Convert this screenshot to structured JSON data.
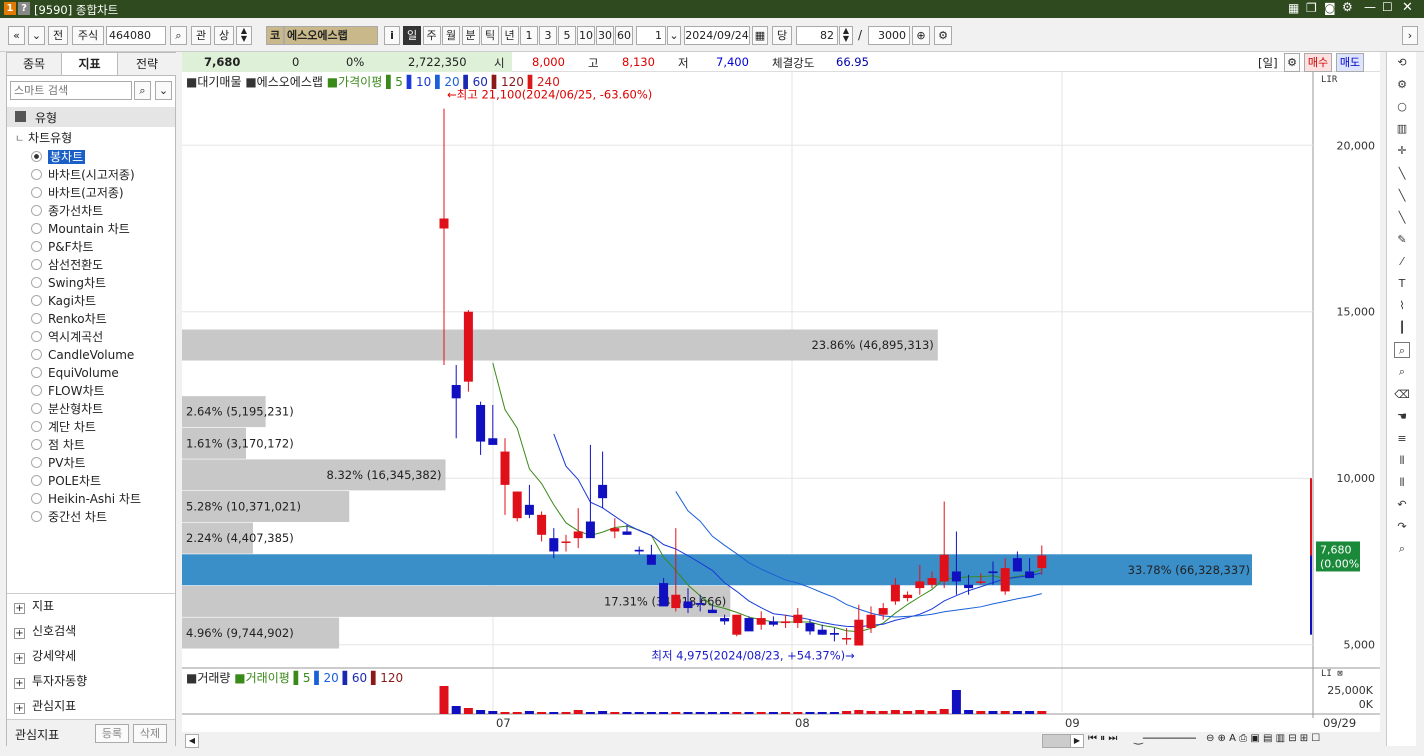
{
  "window": {
    "title": "[9590] 종합차트",
    "icons": [
      "table-icon",
      "copy-icon",
      "camera-icon",
      "gear-icon",
      "minimize-icon",
      "maximize-icon",
      "close-icon"
    ]
  },
  "toolbar": {
    "market": "전",
    "type": "주식",
    "code": "464080",
    "search_icon": "search-icon",
    "btn_gwan": "관",
    "btn_sang": "상",
    "stock_badge": "코",
    "stock_name": "에스오에스랩",
    "info_btn": "i",
    "periods": [
      "일",
      "주",
      "월",
      "분",
      "틱",
      "년"
    ],
    "active_period": "일",
    "intervals": [
      "1",
      "3",
      "5",
      "10",
      "30",
      "60"
    ],
    "count": "1",
    "date": "2024/09/24",
    "dang_label": "당",
    "zoom_value": "82",
    "slash": "/",
    "total": "3000"
  },
  "left_panel": {
    "tabs": [
      "종목",
      "지표",
      "전략"
    ],
    "active_tab": "지표",
    "search_placeholder": "스마트 검색",
    "group": "유형",
    "subgroup": "차트유형",
    "chart_types": [
      "봉차트",
      "바차트(시고저종)",
      "바차트(고저종)",
      "종가선차트",
      "Mountain 차트",
      "P&F차트",
      "삼선전환도",
      "Swing차트",
      "Kagi차트",
      "Renko차트",
      "역시계곡선",
      "CandleVolume",
      "EquiVolume",
      "FLOW차트",
      "분산형차트",
      "계단 차트",
      "점 차트",
      "PV차트",
      "POLE차트",
      "Heikin-Ashi 차트",
      "중간선 차트"
    ],
    "selected": "봉차트",
    "bottom": [
      "지표",
      "신호검색",
      "강세약세",
      "투자자동향",
      "관심지표"
    ],
    "footer": {
      "label": "관심지표",
      "register": "등록",
      "delete": "삭제"
    }
  },
  "info": {
    "price": "7,680",
    "change": "0",
    "rate": "0%",
    "volume": "2,722,350",
    "open_label": "시",
    "open": "8,000",
    "high_label": "고",
    "high": "8,130",
    "low_label": "저",
    "low": "7,400",
    "strength_label": "체결강도",
    "strength": "66.95",
    "period_tag": "[일]",
    "buy": "매수",
    "sell": "매도"
  },
  "chart_data": {
    "type": "candlestick",
    "legend": {
      "vp": "대기매물",
      "name": "에스오에스랩",
      "ma_label": "가격이평",
      "ma": [
        "5",
        "10",
        "20",
        "60",
        "120",
        "240"
      ]
    },
    "ma_colors": {
      "5": "#3a8a1a",
      "10": "#1a3ad8",
      "20": "#1a60d8",
      "60": "#1a2ab0",
      "120": "#8a1a1a",
      "240": "#d81a1a"
    },
    "y_ticks": [
      "20,000",
      "15,000",
      "10,000",
      "5,000"
    ],
    "ylim": [
      4300,
      22200
    ],
    "x_ticks": [
      "07",
      "08",
      "09"
    ],
    "x_end": "09/29",
    "current_price_tag": [
      "7,680",
      "(0.00%)"
    ],
    "high_annotation": "←최고 21,100(2024/06/25, -63.60%)",
    "low_annotation": "최저 4,975(2024/08/23, +54.37%)→",
    "candles": [
      [
        17500,
        21100,
        13400,
        17800
      ],
      [
        12800,
        13400,
        11200,
        12400
      ],
      [
        12900,
        15050,
        12600,
        15000
      ],
      [
        12200,
        12300,
        10700,
        11100
      ],
      [
        11200,
        12200,
        11000,
        11000
      ],
      [
        9800,
        11200,
        8900,
        10800
      ],
      [
        8800,
        9600,
        8700,
        9600
      ],
      [
        9200,
        9800,
        8800,
        8900
      ],
      [
        8300,
        9000,
        8100,
        8900
      ],
      [
        8200,
        8500,
        7600,
        7800
      ],
      [
        8100,
        8300,
        7800,
        8100
      ],
      [
        8200,
        9100,
        7900,
        8400
      ],
      [
        8700,
        11000,
        8500,
        8200
      ],
      [
        9800,
        10800,
        9100,
        9400
      ],
      [
        8400,
        8800,
        8200,
        8500
      ],
      [
        8400,
        8600,
        8300,
        8300
      ],
      [
        7850,
        7950,
        7700,
        7800
      ],
      [
        7700,
        8000,
        7500,
        7400
      ],
      [
        6850,
        7000,
        6600,
        6150
      ],
      [
        6100,
        8500,
        6000,
        6500
      ],
      [
        6300,
        6700,
        5950,
        6100
      ],
      [
        6250,
        6500,
        6000,
        6200
      ],
      [
        6050,
        6200,
        5950,
        5950
      ],
      [
        5800,
        5900,
        5600,
        5700
      ],
      [
        5300,
        5900,
        5250,
        5900
      ],
      [
        5800,
        5850,
        5500,
        5400
      ],
      [
        5600,
        6000,
        5450,
        5800
      ],
      [
        5700,
        5850,
        5550,
        5600
      ],
      [
        5650,
        5900,
        5500,
        5700
      ],
      [
        5650,
        6100,
        5500,
        5900
      ],
      [
        5650,
        5750,
        5300,
        5400
      ],
      [
        5450,
        5600,
        5300,
        5300
      ],
      [
        5350,
        5500,
        5100,
        5300
      ],
      [
        5200,
        5500,
        5000,
        5200
      ],
      [
        4975,
        6200,
        4975,
        5750
      ],
      [
        5500,
        6150,
        5350,
        5900
      ],
      [
        5900,
        6250,
        5750,
        6100
      ],
      [
        6300,
        7000,
        6200,
        6800
      ],
      [
        6400,
        6600,
        6300,
        6500
      ],
      [
        6700,
        7400,
        6500,
        6900
      ],
      [
        6800,
        7200,
        6700,
        7000
      ],
      [
        6900,
        9300,
        6700,
        7700
      ],
      [
        7200,
        8400,
        6500,
        6900
      ],
      [
        6800,
        7100,
        6500,
        6700
      ],
      [
        6900,
        7150,
        6800,
        6900
      ],
      [
        7200,
        7500,
        6800,
        7150
      ],
      [
        6600,
        7600,
        6500,
        7300
      ],
      [
        7600,
        7800,
        7200,
        7200
      ],
      [
        7200,
        7600,
        7000,
        7000
      ],
      [
        7300,
        7980,
        7100,
        7680
      ]
    ],
    "volume_profile": [
      {
        "label": "23.86% (46,895,313)",
        "price": 14000,
        "pct": 23.86,
        "highlight": false
      },
      {
        "label": "2.64% (5,195,231)",
        "price": 12000,
        "pct": 2.64,
        "highlight": false
      },
      {
        "label": "1.61% (3,170,172)",
        "price": 11050,
        "pct": 1.61,
        "highlight": false
      },
      {
        "label": "8.32% (16,345,382)",
        "price": 10100,
        "pct": 8.32,
        "highlight": false
      },
      {
        "label": "5.28% (10,371,021)",
        "price": 9150,
        "pct": 5.28,
        "highlight": false
      },
      {
        "label": "2.24% (4,407,385)",
        "price": 8200,
        "pct": 2.24,
        "highlight": false
      },
      {
        "label": "33.78% (66,328,337)",
        "price": 7250,
        "pct": 33.78,
        "highlight": true
      },
      {
        "label": "17.31% (34,018,666)",
        "price": 6300,
        "pct": 17.31,
        "highlight": false
      },
      {
        "label": "4.96% (9,744,902)",
        "price": 5350,
        "pct": 4.96,
        "highlight": false
      }
    ],
    "volume_legend": {
      "name": "거래량",
      "ma_label": "거래이평",
      "ma": [
        "5",
        "20",
        "60",
        "120"
      ]
    },
    "volume_ticks": [
      "25,000K",
      "0K"
    ]
  },
  "right_tools": [
    "refresh-icon",
    "gear-icon",
    "circle-icon",
    "chart-icon",
    "crosshair-icon",
    "line-icon",
    "line-icon",
    "line-icon",
    "pen-icon",
    "auto-line-icon",
    "text-icon",
    "brush-icon",
    "candle-icon",
    "zoom-icon",
    "zoom-icon",
    "erase-icon",
    "hand-icon",
    "fib-icon",
    "grid-icon",
    "grid-icon",
    "undo-icon",
    "redo-icon",
    "search-icon"
  ]
}
